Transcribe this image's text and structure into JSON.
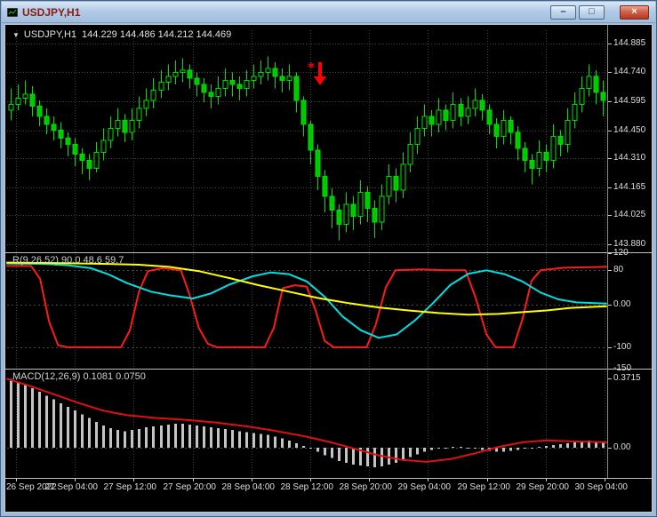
{
  "window": {
    "title": "USDJPY,H1",
    "buttons": {
      "minimize": "–",
      "restore": "□",
      "close": "×"
    }
  },
  "overlay": {
    "main": {
      "marker": "▼",
      "symbol": "USDJPY,H1",
      "ohlc": "144.229 144.486 144.212 144.469"
    },
    "ind1": {
      "name": "R(9,26,52)",
      "values": "90.0 48.6 59.7"
    },
    "ind2": {
      "name": "MACD(12,26,9)",
      "values": "0.1081 0.0750"
    }
  },
  "axes": {
    "price": [
      "144.885",
      "144.740",
      "144.595",
      "144.450",
      "144.310",
      "144.165",
      "144.025",
      "143.880"
    ],
    "oscillator": [
      "120",
      "80",
      "0.00",
      "-100",
      "-150"
    ],
    "macd": [
      "0.3715",
      "0.00"
    ],
    "time": [
      "26 Sep 2022",
      "27 Sep 04:00",
      "27 Sep 12:00",
      "27 Sep 20:00",
      "28 Sep 04:00",
      "28 Sep 12:00",
      "28 Sep 20:00",
      "29 Sep 04:00",
      "29 Sep 12:00",
      "29 Sep 20:00",
      "30 Sep 04:00"
    ]
  },
  "annotations": {
    "star_glyph": "*",
    "arrow_direction": "down",
    "color": "#ff0000"
  },
  "colors": {
    "background": "#000000",
    "grid": "#3f3f3f",
    "level": "#4a4a4a",
    "candle_outline": "#00e000",
    "bear_fill": "#00c800",
    "bull_fill": "#000000",
    "axis_text": "#dfdfdf",
    "wpr_fast": "#ff1a1a",
    "wpr_slow": "#00e0e0",
    "wpr_signal": "#ffff00",
    "macd_histogram": "#c4c4c4",
    "macd_signal": "#dd1111",
    "separator": "#c0c0c0",
    "annotation": "#ff0000",
    "title_text": "#8b1a10"
  },
  "chart_data": [
    {
      "type": "candlestick",
      "panel": "price",
      "symbol": "USDJPY",
      "timeframe": "H1",
      "grid": true,
      "ylim": [
        143.84,
        144.95
      ],
      "ohlc": [
        [
          144.55,
          144.66,
          144.5,
          144.58
        ],
        [
          144.58,
          144.68,
          144.55,
          144.61
        ],
        [
          144.61,
          144.7,
          144.58,
          144.63
        ],
        [
          144.63,
          144.67,
          144.52,
          144.57
        ],
        [
          144.57,
          144.6,
          144.47,
          144.52
        ],
        [
          144.52,
          144.56,
          144.43,
          144.48
        ],
        [
          144.48,
          144.52,
          144.4,
          144.45
        ],
        [
          144.45,
          144.49,
          144.36,
          144.41
        ],
        [
          144.41,
          144.44,
          144.32,
          144.38
        ],
        [
          144.38,
          144.41,
          144.27,
          144.33
        ],
        [
          144.33,
          144.36,
          144.23,
          144.3
        ],
        [
          144.3,
          144.33,
          144.2,
          144.26
        ],
        [
          144.26,
          144.39,
          144.24,
          144.34
        ],
        [
          144.34,
          144.46,
          144.3,
          144.4
        ],
        [
          144.4,
          144.52,
          144.36,
          144.46
        ],
        [
          144.46,
          144.56,
          144.42,
          144.5
        ],
        [
          144.5,
          144.53,
          144.39,
          144.44
        ],
        [
          144.44,
          144.56,
          144.4,
          144.5
        ],
        [
          144.5,
          144.62,
          144.46,
          144.56
        ],
        [
          144.56,
          144.66,
          144.52,
          144.6
        ],
        [
          144.6,
          144.71,
          144.56,
          144.65
        ],
        [
          144.65,
          144.75,
          144.61,
          144.69
        ],
        [
          144.69,
          144.78,
          144.65,
          144.72
        ],
        [
          144.72,
          144.8,
          144.68,
          144.74
        ],
        [
          144.74,
          144.81,
          144.69,
          144.75
        ],
        [
          144.75,
          144.78,
          144.66,
          144.71
        ],
        [
          144.71,
          144.74,
          144.62,
          144.68
        ],
        [
          144.68,
          144.71,
          144.59,
          144.64
        ],
        [
          144.64,
          144.68,
          144.56,
          144.62
        ],
        [
          144.62,
          144.72,
          144.58,
          144.66
        ],
        [
          144.66,
          144.76,
          144.62,
          144.7
        ],
        [
          144.7,
          144.74,
          144.62,
          144.68
        ],
        [
          144.68,
          144.72,
          144.6,
          144.66
        ],
        [
          144.66,
          144.75,
          144.62,
          144.7
        ],
        [
          144.7,
          144.78,
          144.66,
          144.72
        ],
        [
          144.72,
          144.8,
          144.68,
          144.74
        ],
        [
          144.74,
          144.82,
          144.7,
          144.76
        ],
        [
          144.76,
          144.79,
          144.66,
          144.72
        ],
        [
          144.72,
          144.76,
          144.64,
          144.7
        ],
        [
          144.7,
          144.78,
          144.65,
          144.72
        ],
        [
          144.72,
          144.74,
          144.54,
          144.6
        ],
        [
          144.6,
          144.62,
          144.42,
          144.48
        ],
        [
          144.48,
          144.5,
          144.28,
          144.35
        ],
        [
          144.35,
          144.38,
          144.15,
          144.22
        ],
        [
          144.22,
          144.25,
          144.04,
          144.12
        ],
        [
          144.12,
          144.16,
          143.96,
          144.05
        ],
        [
          144.05,
          144.08,
          143.9,
          143.98
        ],
        [
          143.98,
          144.14,
          143.94,
          144.08
        ],
        [
          144.08,
          144.12,
          143.95,
          144.02
        ],
        [
          144.02,
          144.2,
          143.98,
          144.14
        ],
        [
          144.14,
          144.17,
          143.99,
          144.06
        ],
        [
          144.06,
          144.1,
          143.91,
          143.99
        ],
        [
          143.99,
          144.18,
          143.95,
          144.12
        ],
        [
          144.12,
          144.28,
          144.08,
          144.22
        ],
        [
          144.22,
          144.26,
          144.09,
          144.15
        ],
        [
          144.15,
          144.34,
          144.11,
          144.28
        ],
        [
          144.28,
          144.44,
          144.24,
          144.38
        ],
        [
          144.38,
          144.52,
          144.33,
          144.46
        ],
        [
          144.46,
          144.58,
          144.42,
          144.52
        ],
        [
          144.52,
          144.55,
          144.42,
          144.48
        ],
        [
          144.48,
          144.61,
          144.44,
          144.55
        ],
        [
          144.55,
          144.58,
          144.45,
          144.5
        ],
        [
          144.5,
          144.64,
          144.46,
          144.58
        ],
        [
          144.58,
          144.61,
          144.47,
          144.52
        ],
        [
          144.52,
          144.62,
          144.48,
          144.56
        ],
        [
          144.56,
          144.66,
          144.52,
          144.6
        ],
        [
          144.6,
          144.63,
          144.5,
          144.55
        ],
        [
          144.55,
          144.58,
          144.43,
          144.48
        ],
        [
          144.48,
          144.51,
          144.36,
          144.42
        ],
        [
          144.42,
          144.55,
          144.38,
          144.5
        ],
        [
          144.5,
          144.52,
          144.38,
          144.44
        ],
        [
          144.44,
          144.47,
          144.3,
          144.36
        ],
        [
          144.36,
          144.39,
          144.24,
          144.3
        ],
        [
          144.3,
          144.33,
          144.18,
          144.26
        ],
        [
          144.26,
          144.4,
          144.22,
          144.34
        ],
        [
          144.34,
          144.38,
          144.24,
          144.3
        ],
        [
          144.3,
          144.48,
          144.26,
          144.42
        ],
        [
          144.42,
          144.45,
          144.32,
          144.38
        ],
        [
          144.38,
          144.56,
          144.34,
          144.5
        ],
        [
          144.5,
          144.64,
          144.46,
          144.58
        ],
        [
          144.58,
          144.72,
          144.54,
          144.66
        ],
        [
          144.66,
          144.78,
          144.62,
          144.72
        ],
        [
          144.72,
          144.75,
          144.58,
          144.64
        ],
        [
          144.64,
          144.7,
          144.52,
          144.6
        ]
      ]
    },
    {
      "type": "line",
      "panel": "oscillator",
      "label": "R(9,26,52)",
      "current_values": [
        90.0,
        48.6,
        59.7
      ],
      "ylim": [
        -150,
        120
      ],
      "levels": [
        80,
        0,
        -100
      ],
      "series": [
        {
          "name": "wpr-fast",
          "color_key": "wpr_fast",
          "points": [
            [
              0,
              90
            ],
            [
              0.04,
              90
            ],
            [
              0.055,
              60
            ],
            [
              0.07,
              -40
            ],
            [
              0.085,
              -95
            ],
            [
              0.1,
              -100
            ],
            [
              0.19,
              -100
            ],
            [
              0.205,
              -60
            ],
            [
              0.22,
              30
            ],
            [
              0.235,
              78
            ],
            [
              0.26,
              85
            ],
            [
              0.29,
              80
            ],
            [
              0.305,
              20
            ],
            [
              0.32,
              -55
            ],
            [
              0.335,
              -92
            ],
            [
              0.35,
              -100
            ],
            [
              0.43,
              -100
            ],
            [
              0.445,
              -55
            ],
            [
              0.46,
              38
            ],
            [
              0.48,
              45
            ],
            [
              0.5,
              42
            ],
            [
              0.515,
              -15
            ],
            [
              0.53,
              -85
            ],
            [
              0.545,
              -100
            ],
            [
              0.6,
              -100
            ],
            [
              0.615,
              -48
            ],
            [
              0.632,
              40
            ],
            [
              0.648,
              80
            ],
            [
              0.69,
              82
            ],
            [
              0.73,
              80
            ],
            [
              0.765,
              80
            ],
            [
              0.782,
              15
            ],
            [
              0.8,
              -70
            ],
            [
              0.815,
              -100
            ],
            [
              0.845,
              -100
            ],
            [
              0.86,
              -35
            ],
            [
              0.875,
              55
            ],
            [
              0.89,
              80
            ],
            [
              0.93,
              86
            ],
            [
              1,
              88
            ]
          ]
        },
        {
          "name": "wpr-slow",
          "color_key": "wpr_slow",
          "points": [
            [
              0,
              96
            ],
            [
              0.06,
              95
            ],
            [
              0.1,
              92
            ],
            [
              0.14,
              85
            ],
            [
              0.17,
              70
            ],
            [
              0.2,
              50
            ],
            [
              0.24,
              30
            ],
            [
              0.27,
              22
            ],
            [
              0.31,
              14
            ],
            [
              0.34,
              26
            ],
            [
              0.37,
              46
            ],
            [
              0.41,
              66
            ],
            [
              0.44,
              75
            ],
            [
              0.47,
              71
            ],
            [
              0.5,
              54
            ],
            [
              0.53,
              18
            ],
            [
              0.56,
              -28
            ],
            [
              0.59,
              -60
            ],
            [
              0.62,
              -78
            ],
            [
              0.65,
              -70
            ],
            [
              0.68,
              -38
            ],
            [
              0.71,
              2
            ],
            [
              0.74,
              46
            ],
            [
              0.77,
              72
            ],
            [
              0.8,
              80
            ],
            [
              0.83,
              71
            ],
            [
              0.86,
              54
            ],
            [
              0.89,
              28
            ],
            [
              0.92,
              12
            ],
            [
              0.95,
              5
            ],
            [
              1,
              2
            ]
          ]
        },
        {
          "name": "wpr-signal",
          "color_key": "wpr_signal",
          "points": [
            [
              0,
              98
            ],
            [
              0.08,
              97
            ],
            [
              0.16,
              95
            ],
            [
              0.22,
              93
            ],
            [
              0.27,
              88
            ],
            [
              0.32,
              78
            ],
            [
              0.37,
              62
            ],
            [
              0.42,
              45
            ],
            [
              0.47,
              30
            ],
            [
              0.52,
              15
            ],
            [
              0.57,
              3
            ],
            [
              0.62,
              -7
            ],
            [
              0.67,
              -14
            ],
            [
              0.72,
              -20
            ],
            [
              0.77,
              -24
            ],
            [
              0.82,
              -22
            ],
            [
              0.86,
              -18
            ],
            [
              0.9,
              -14
            ],
            [
              0.94,
              -8
            ],
            [
              1,
              -4
            ]
          ]
        }
      ]
    },
    {
      "type": "macd",
      "panel": "macd",
      "label": "MACD(12,26,9)",
      "current_values": [
        0.1081,
        0.075
      ],
      "ylim": [
        -0.161,
        0.42
      ],
      "zero_line": 0,
      "values": [
        0.37,
        0.355,
        0.34,
        0.32,
        0.3,
        0.28,
        0.26,
        0.24,
        0.22,
        0.2,
        0.18,
        0.16,
        0.14,
        0.12,
        0.105,
        0.095,
        0.09,
        0.095,
        0.1,
        0.11,
        0.115,
        0.12,
        0.125,
        0.13,
        0.13,
        0.125,
        0.12,
        0.115,
        0.11,
        0.105,
        0.1,
        0.095,
        0.09,
        0.085,
        0.08,
        0.075,
        0.07,
        0.06,
        0.05,
        0.04,
        0.025,
        0.01,
        -0.005,
        -0.02,
        -0.04,
        -0.055,
        -0.07,
        -0.08,
        -0.09,
        -0.095,
        -0.1,
        -0.105,
        -0.1,
        -0.09,
        -0.08,
        -0.065,
        -0.05,
        -0.035,
        -0.02,
        -0.01,
        -0.005,
        0.0,
        0.005,
        0.005,
        0.0,
        -0.005,
        -0.01,
        -0.015,
        -0.02,
        -0.02,
        -0.015,
        -0.01,
        -0.005,
        0.0,
        0.005,
        0.01,
        0.015,
        0.02,
        0.025,
        0.03,
        0.035,
        0.04,
        0.035,
        0.03
      ],
      "signal": {
        "color_key": "macd_signal",
        "points": [
          [
            0,
            0.37
          ],
          [
            0.04,
            0.33
          ],
          [
            0.08,
            0.285
          ],
          [
            0.12,
            0.24
          ],
          [
            0.16,
            0.2
          ],
          [
            0.2,
            0.175
          ],
          [
            0.25,
            0.16
          ],
          [
            0.3,
            0.15
          ],
          [
            0.35,
            0.135
          ],
          [
            0.4,
            0.115
          ],
          [
            0.45,
            0.09
          ],
          [
            0.5,
            0.06
          ],
          [
            0.54,
            0.03
          ],
          [
            0.58,
            -0.005
          ],
          [
            0.62,
            -0.04
          ],
          [
            0.66,
            -0.065
          ],
          [
            0.7,
            -0.075
          ],
          [
            0.74,
            -0.06
          ],
          [
            0.78,
            -0.03
          ],
          [
            0.82,
            0.005
          ],
          [
            0.86,
            0.03
          ],
          [
            0.9,
            0.04
          ],
          [
            0.94,
            0.035
          ],
          [
            1,
            0.03
          ]
        ]
      }
    }
  ]
}
